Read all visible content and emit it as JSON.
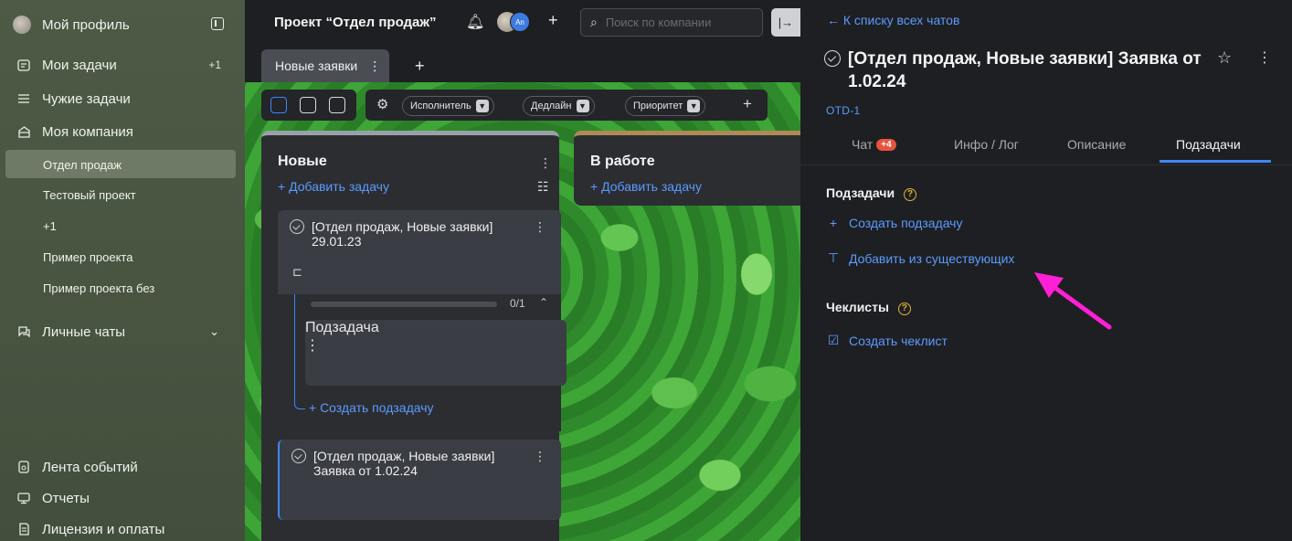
{
  "sidebar": {
    "profile": "Мой профиль",
    "my_tasks": "Мои задачи",
    "my_tasks_count": "+1",
    "others_tasks": "Чужие задачи",
    "my_company": "Моя компания",
    "projects": [
      "Отдел продаж",
      "Тестовый проект",
      "+1",
      "Пример проекта",
      "Пример проекта без"
    ],
    "personal_chats": "Личные чаты",
    "events": "Лента событий",
    "reports": "Отчеты",
    "license": "Лицензия и оплаты"
  },
  "board": {
    "project_title": "Проект “Отдел продаж”",
    "avatar_initials": "An",
    "search_placeholder": "Поиск по компании",
    "tab": "Новые заявки",
    "filters": [
      "Исполнитель",
      "Дедлайн",
      "Приоритет"
    ],
    "columns": [
      {
        "title": "Новые",
        "add": "+ Добавить задачу"
      },
      {
        "title": "В работе",
        "add": "+ Добавить задачу"
      }
    ],
    "card1": "[Отдел продаж, Новые заявки] 29.01.23",
    "progress_label": "0/1",
    "progress_value": 0,
    "subtask": "Подзадача",
    "create_subtask": "+ Создать подзадачу",
    "card2": "[Отдел продаж, Новые заявки] Заявка от 1.02.24"
  },
  "panel": {
    "back": "← К списку всех чатов",
    "title": "[Отдел продаж, Новые заявки] Заявка от 1.02.24",
    "code": "OTD-1",
    "tabs": {
      "chat": "Чат",
      "chat_badge": "+4",
      "info": "Инфо / Лог",
      "description": "Описание",
      "subtasks": "Подзадачи"
    },
    "subtasks_title": "Подзадачи",
    "create_subtask": "Создать подзадачу",
    "add_existing": "Добавить из существующих",
    "checklists_title": "Чеклисты",
    "create_checklist": "Создать чеклист"
  },
  "colors": {
    "accent": "#3d87ff",
    "link": "#5c9bff",
    "badge": "#e8533e",
    "annotation_arrow": "#ff1fd6"
  }
}
